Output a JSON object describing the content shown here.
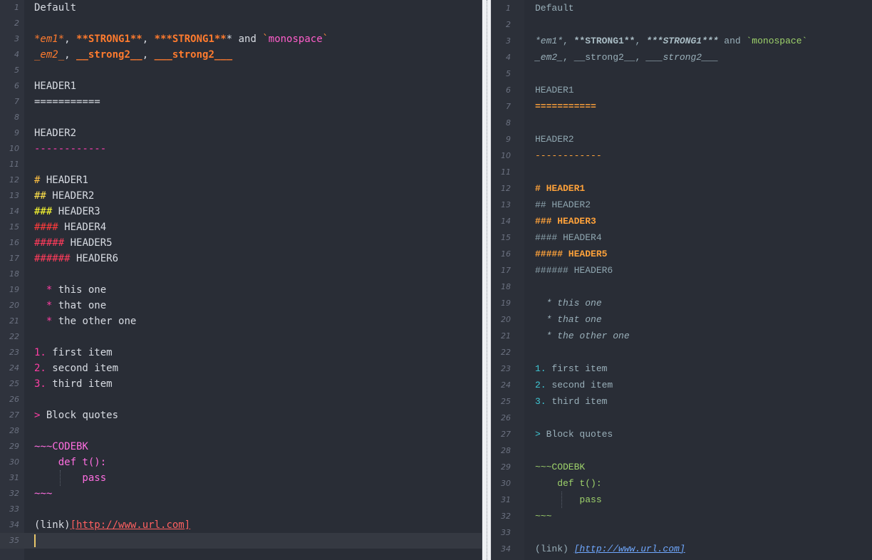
{
  "left_pane": {
    "lines": [
      {
        "n": "1",
        "segs": [
          {
            "t": "Default",
            "c": "l-txt"
          }
        ]
      },
      {
        "n": "2",
        "segs": []
      },
      {
        "n": "3",
        "segs": [
          {
            "t": "*em1*",
            "c": "l-em"
          },
          {
            "t": ", ",
            "c": "l-punc"
          },
          {
            "t": "**STRONG1**",
            "c": "l-strong"
          },
          {
            "t": ", ",
            "c": "l-punc"
          },
          {
            "t": "***STRONG1**",
            "c": "l-strong"
          },
          {
            "t": "* and ",
            "c": "l-punc"
          },
          {
            "t": "`",
            "c": "l-tick"
          },
          {
            "t": "monospace",
            "c": "l-mono"
          },
          {
            "t": "`",
            "c": "l-tick"
          }
        ]
      },
      {
        "n": "4",
        "segs": [
          {
            "t": "_em2_",
            "c": "l-em"
          },
          {
            "t": ", ",
            "c": "l-punc"
          },
          {
            "t": "__strong2__",
            "c": "l-strong"
          },
          {
            "t": ", ",
            "c": "l-punc"
          },
          {
            "t": "___strong2___",
            "c": "l-strong"
          }
        ]
      },
      {
        "n": "5",
        "segs": []
      },
      {
        "n": "6",
        "segs": [
          {
            "t": "HEADER1",
            "c": "l-txt"
          }
        ]
      },
      {
        "n": "7",
        "segs": [
          {
            "t": "===========",
            "c": "l-under1"
          }
        ]
      },
      {
        "n": "8",
        "segs": []
      },
      {
        "n": "9",
        "segs": [
          {
            "t": "HEADER2",
            "c": "l-txt"
          }
        ]
      },
      {
        "n": "10",
        "segs": [
          {
            "t": "------------",
            "c": "l-under2"
          }
        ]
      },
      {
        "n": "11",
        "segs": []
      },
      {
        "n": "12",
        "segs": [
          {
            "t": "#",
            "c": "l-h1"
          },
          {
            "t": " HEADER1",
            "c": "l-txt"
          }
        ]
      },
      {
        "n": "13",
        "segs": [
          {
            "t": "##",
            "c": "l-h2"
          },
          {
            "t": " HEADER2",
            "c": "l-txt"
          }
        ]
      },
      {
        "n": "14",
        "segs": [
          {
            "t": "###",
            "c": "l-h3"
          },
          {
            "t": " HEADER3",
            "c": "l-txt"
          }
        ]
      },
      {
        "n": "15",
        "segs": [
          {
            "t": "####",
            "c": "l-h4"
          },
          {
            "t": " HEADER4",
            "c": "l-txt"
          }
        ]
      },
      {
        "n": "16",
        "segs": [
          {
            "t": "#####",
            "c": "l-h5"
          },
          {
            "t": " HEADER5",
            "c": "l-txt"
          }
        ]
      },
      {
        "n": "17",
        "segs": [
          {
            "t": "######",
            "c": "l-h6"
          },
          {
            "t": " HEADER6",
            "c": "l-txt"
          }
        ]
      },
      {
        "n": "18",
        "segs": []
      },
      {
        "n": "19",
        "segs": [
          {
            "t": "  ",
            "c": "l-txt"
          },
          {
            "t": "*",
            "c": "l-bullet"
          },
          {
            "t": " this one",
            "c": "l-txt"
          }
        ]
      },
      {
        "n": "20",
        "segs": [
          {
            "t": "  ",
            "c": "l-txt"
          },
          {
            "t": "*",
            "c": "l-bullet"
          },
          {
            "t": " that one",
            "c": "l-txt"
          }
        ]
      },
      {
        "n": "21",
        "segs": [
          {
            "t": "  ",
            "c": "l-txt"
          },
          {
            "t": "*",
            "c": "l-bullet"
          },
          {
            "t": " the other one",
            "c": "l-txt"
          }
        ]
      },
      {
        "n": "22",
        "segs": []
      },
      {
        "n": "23",
        "segs": [
          {
            "t": "1.",
            "c": "l-num"
          },
          {
            "t": " first item",
            "c": "l-txt"
          }
        ]
      },
      {
        "n": "24",
        "segs": [
          {
            "t": "2.",
            "c": "l-num"
          },
          {
            "t": " second item",
            "c": "l-txt"
          }
        ]
      },
      {
        "n": "25",
        "segs": [
          {
            "t": "3.",
            "c": "l-num"
          },
          {
            "t": " third item",
            "c": "l-txt"
          }
        ]
      },
      {
        "n": "26",
        "segs": []
      },
      {
        "n": "27",
        "segs": [
          {
            "t": ">",
            "c": "l-quote"
          },
          {
            "t": " Block quotes",
            "c": "l-txt"
          }
        ]
      },
      {
        "n": "28",
        "segs": []
      },
      {
        "n": "29",
        "segs": [
          {
            "t": "~~~CODEBK",
            "c": "l-code"
          }
        ]
      },
      {
        "n": "30",
        "segs": [
          {
            "t": "    def t():",
            "c": "l-code"
          }
        ]
      },
      {
        "n": "31",
        "segs": [
          {
            "t": "        pass",
            "c": "l-code"
          }
        ]
      },
      {
        "n": "32",
        "segs": [
          {
            "t": "~~~",
            "c": "l-code"
          }
        ]
      },
      {
        "n": "33",
        "segs": []
      },
      {
        "n": "34",
        "segs": [
          {
            "t": "(link)",
            "c": "l-txt"
          },
          {
            "t": "[",
            "c": "l-url"
          },
          {
            "t": "http://www.url.com",
            "c": "l-url"
          },
          {
            "t": "]",
            "c": "l-url"
          }
        ]
      },
      {
        "n": "35",
        "segs": [],
        "current": true
      }
    ]
  },
  "right_pane": {
    "lines": [
      {
        "n": "1",
        "segs": [
          {
            "t": "Default",
            "c": "r-txt"
          }
        ]
      },
      {
        "n": "2",
        "segs": []
      },
      {
        "n": "3",
        "segs": [
          {
            "t": "*em1*",
            "c": "r-em"
          },
          {
            "t": ", ",
            "c": "r-txt"
          },
          {
            "t": "**STRONG1**",
            "c": "r-strong"
          },
          {
            "t": ", ",
            "c": "r-txt"
          },
          {
            "t": "***STRONG1***",
            "c": "r-strongem"
          },
          {
            "t": " and ",
            "c": "r-txt"
          },
          {
            "t": "`monospace`",
            "c": "r-mono"
          }
        ]
      },
      {
        "n": "4",
        "segs": [
          {
            "t": "_em2_",
            "c": "r-em"
          },
          {
            "t": ", ",
            "c": "r-txt"
          },
          {
            "t": "__strong2__",
            "c": "r-txt"
          },
          {
            "t": ", ",
            "c": "r-txt"
          },
          {
            "t": "___strong2___",
            "c": "r-em"
          }
        ]
      },
      {
        "n": "5",
        "segs": []
      },
      {
        "n": "6",
        "segs": [
          {
            "t": "HEADER1",
            "c": "r-hplain"
          }
        ]
      },
      {
        "n": "7",
        "segs": [
          {
            "t": "===========",
            "c": "r-under"
          }
        ]
      },
      {
        "n": "8",
        "segs": []
      },
      {
        "n": "9",
        "segs": [
          {
            "t": "HEADER2",
            "c": "r-hplain"
          }
        ]
      },
      {
        "n": "10",
        "segs": [
          {
            "t": "------------",
            "c": "r-under2"
          }
        ]
      },
      {
        "n": "11",
        "segs": []
      },
      {
        "n": "12",
        "segs": [
          {
            "t": "# HEADER1",
            "c": "r-hbold"
          }
        ]
      },
      {
        "n": "13",
        "segs": [
          {
            "t": "## HEADER2",
            "c": "r-hplain"
          }
        ]
      },
      {
        "n": "14",
        "segs": [
          {
            "t": "### HEADER3",
            "c": "r-hbold"
          }
        ]
      },
      {
        "n": "15",
        "segs": [
          {
            "t": "#### HEADER4",
            "c": "r-hplain"
          }
        ]
      },
      {
        "n": "16",
        "segs": [
          {
            "t": "##### HEADER5",
            "c": "r-hbold"
          }
        ]
      },
      {
        "n": "17",
        "segs": [
          {
            "t": "###### HEADER6",
            "c": "r-hplain"
          }
        ]
      },
      {
        "n": "18",
        "segs": []
      },
      {
        "n": "19",
        "segs": [
          {
            "t": "  * this one",
            "c": "r-list"
          }
        ]
      },
      {
        "n": "20",
        "segs": [
          {
            "t": "  * that one",
            "c": "r-list"
          }
        ]
      },
      {
        "n": "21",
        "segs": [
          {
            "t": "  * the other one",
            "c": "r-list"
          }
        ]
      },
      {
        "n": "22",
        "segs": []
      },
      {
        "n": "23",
        "segs": [
          {
            "t": "1.",
            "c": "r-num"
          },
          {
            "t": " first item",
            "c": "r-txt"
          }
        ]
      },
      {
        "n": "24",
        "segs": [
          {
            "t": "2.",
            "c": "r-num"
          },
          {
            "t": " second item",
            "c": "r-txt"
          }
        ]
      },
      {
        "n": "25",
        "segs": [
          {
            "t": "3.",
            "c": "r-num"
          },
          {
            "t": " third item",
            "c": "r-txt"
          }
        ]
      },
      {
        "n": "26",
        "segs": []
      },
      {
        "n": "27",
        "segs": [
          {
            "t": ">",
            "c": "r-quote"
          },
          {
            "t": " Block quotes",
            "c": "r-txt"
          }
        ]
      },
      {
        "n": "28",
        "segs": []
      },
      {
        "n": "29",
        "segs": [
          {
            "t": "~~~CODEBK",
            "c": "r-code"
          }
        ]
      },
      {
        "n": "30",
        "segs": [
          {
            "t": "    def t():",
            "c": "r-code"
          }
        ]
      },
      {
        "n": "31",
        "segs": [
          {
            "t": "        pass",
            "c": "r-code"
          }
        ]
      },
      {
        "n": "32",
        "segs": [
          {
            "t": "~~~",
            "c": "r-code"
          }
        ]
      },
      {
        "n": "33",
        "segs": []
      },
      {
        "n": "34",
        "segs": [
          {
            "t": "(link) ",
            "c": "r-txt"
          },
          {
            "t": "[http://www.url.com]",
            "c": "r-url"
          }
        ]
      }
    ]
  },
  "colors": {
    "editor_bg": "#292d36",
    "gutter_bg": "#2f333d",
    "splitter_bg": "#eef0f3",
    "caret": "#e8c66a"
  }
}
